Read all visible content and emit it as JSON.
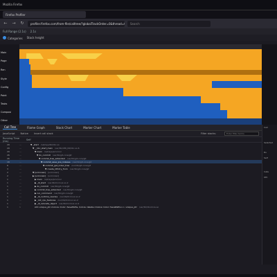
{
  "window_title": "Mozilla Firefox",
  "tab": {
    "label": "Firefox Profiler"
  },
  "url": "profiler.firefox.com/from-file/calltree/?globalTrackOrder=0&thread=0&v=10",
  "search": {
    "placeholder": "Search"
  },
  "range": {
    "full_range": "Full Range (2.1s)",
    "sub": "2.1s"
  },
  "track_header": {
    "categories": "Categories",
    "stack_height": "Stack height"
  },
  "track_labels": [
    "Main",
    "Page",
    "Ren",
    "Style",
    "Config",
    "Paint",
    "Tasks",
    "Composi",
    "Other"
  ],
  "bottom_tabs": [
    "Call Tree",
    "Flame Graph",
    "Stack Chart",
    "Marker Chart",
    "Marker Table"
  ],
  "bottom_active": "Call Tree",
  "toolbar": {
    "javascript": "JavaScript",
    "native": "Native",
    "invert": "Invert call stack",
    "filter_label": "Filter stacks:",
    "filter_placeholder": "Enter filter terms"
  },
  "columns": {
    "running": "Running Time (ms)",
    "self": "Self",
    "tree": ""
  },
  "sidebar": {
    "title": "Call",
    "items": [
      "Call",
      "Selected",
      "Ru",
      "Self",
      "Cate",
      "Oth"
    ]
  },
  "rows": [
    {
      "total": "29",
      "self": "—",
      "name": "▼ _start",
      "lib": "/opt/sys/lib/libc.so"
    },
    {
      "total": "29",
      "self": "—",
      "name": "▼ __libc_start_main",
      "lib": "/usr/lib/x86_64/libc.so.6"
    },
    {
      "total": "29",
      "self": "—",
      "name": "▼ main",
      "lib": "/opt/sys/proc/run"
    },
    {
      "total": "26",
      "self": "—",
      "name": "▼ do_commit",
      "lib": "/usr/lib/git-core/git"
    },
    {
      "total": "26",
      "self": "—",
      "name": "▼ commit_tree_extended",
      "lib": "/usr/lib/git-core/git"
    },
    {
      "total": "18",
      "self": "—",
      "name": "▼ commit_save_pre_indexes",
      "lib": "/usr/lib/git-core/git"
    },
    {
      "total": "6",
      "self": "—",
      "name": "▼ commit_get_index_tree",
      "lib": "/usr/lib/git-core/git"
    },
    {
      "total": "3",
      "self": "—",
      "name": "▼ create_CEntry_from",
      "lib": "/usr/lib/git-core/git"
    },
    {
      "total": "2",
      "self": "—",
      "name": "▼ [unknown]",
      "lib": "[unknown]"
    },
    {
      "total": "2",
      "self": "—",
      "name": "▶ [unknown]",
      "lib": "[unknown]"
    },
    {
      "total": "1",
      "self": "—",
      "name": "▶ main",
      "lib": "/opt/sys/proc/run"
    },
    {
      "total": "1",
      "self": "—",
      "name": "▶ _dl_start",
      "lib": "/usr/lib/ld-linux.so.2"
    },
    {
      "total": "1",
      "self": "—",
      "name": "▶ do_commit",
      "lib": "/usr/lib/git-core/git"
    },
    {
      "total": "1",
      "self": "—",
      "name": "▶ commit_tree_extended",
      "lib": "/usr/lib/git-core/git"
    },
    {
      "total": "1",
      "self": "—",
      "name": "▶ run_command",
      "lib": "/usr/lib/git-core/git"
    },
    {
      "total": "1",
      "self": "—",
      "name": "▶ _dl_runtime_resolve",
      "lib": "/usr/lib/ld-linux.so.2"
    },
    {
      "total": "1",
      "self": "—",
      "name": "▶ _init_cpu_features",
      "lib": "/usr/lib/ld-linux.so.2"
    },
    {
      "total": "1",
      "self": "—",
      "name": "▶ _dl_relocate_object",
      "lib": "/usr/lib/ld-linux.so.2"
    },
    {
      "total": "1",
      "self": "1",
      "name": "std::unique_ptr<Colore::Color::SavePaths, Colore::delete<Colore::Color::SavePaths>>::unique_ptr",
      "lib": "/usr/lib/libcolore.so"
    }
  ],
  "colors": {
    "accent": "#3b8de0",
    "orange": "#f5a623",
    "yellow": "#f8d048",
    "blue_bg": "#1f5fbf"
  }
}
